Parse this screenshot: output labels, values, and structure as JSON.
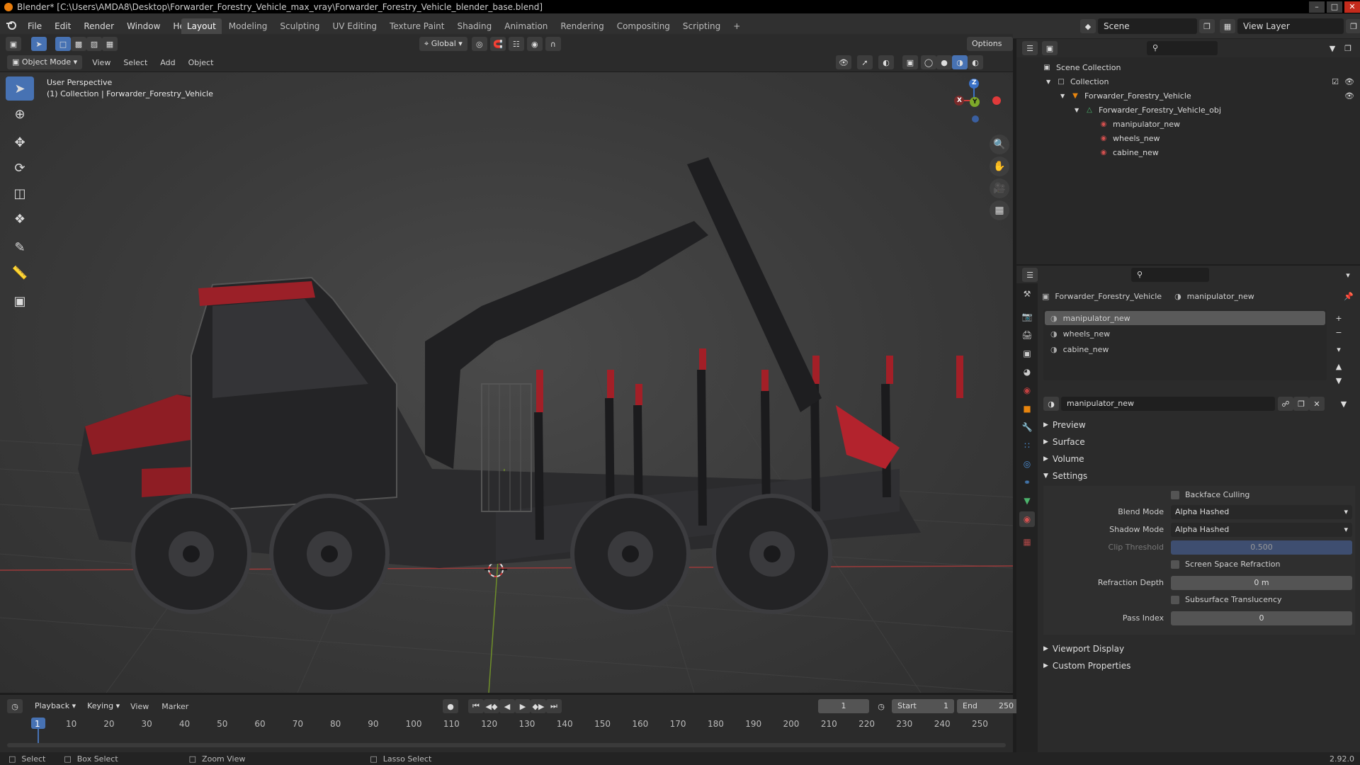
{
  "title": "Blender* [C:\\Users\\AMDA8\\Desktop\\Forwarder_Forestry_Vehicle_max_vray\\Forwarder_Forestry_Vehicle_blender_base.blend]",
  "menu": [
    "File",
    "Edit",
    "Render",
    "Window",
    "Help"
  ],
  "workspaces": [
    "Layout",
    "Modeling",
    "Sculpting",
    "UV Editing",
    "Texture Paint",
    "Shading",
    "Animation",
    "Rendering",
    "Compositing",
    "Scripting"
  ],
  "scene": "Scene",
  "view_layer": "View Layer",
  "viewport": {
    "transform": "Global",
    "options": "Options",
    "mode": "Object Mode",
    "menus": [
      "View",
      "Select",
      "Add",
      "Object"
    ],
    "perspective": "User Perspective",
    "collection_info": "(1) Collection | Forwarder_Forestry_Vehicle",
    "gizmo": {
      "x": "X",
      "y": "Y",
      "z": "Z"
    }
  },
  "outliner": {
    "rows": [
      {
        "label": "Scene Collection",
        "indent": 0,
        "icon": "scene-collection-icon"
      },
      {
        "label": "Collection",
        "indent": 1,
        "icon": "collection-icon"
      },
      {
        "label": "Forwarder_Forestry_Vehicle",
        "indent": 2,
        "icon": "object-icon"
      },
      {
        "label": "Forwarder_Forestry_Vehicle_obj",
        "indent": 3,
        "icon": "mesh-data-icon"
      },
      {
        "label": "manipulator_new",
        "indent": 4,
        "icon": "material-icon"
      },
      {
        "label": "wheels_new",
        "indent": 4,
        "icon": "material-icon"
      },
      {
        "label": "cabine_new",
        "indent": 4,
        "icon": "material-icon"
      }
    ]
  },
  "properties": {
    "breadcrumb_object": "Forwarder_Forestry_Vehicle",
    "breadcrumb_material": "manipulator_new",
    "slots": [
      "manipulator_new",
      "wheels_new",
      "cabine_new"
    ],
    "active_material": "manipulator_new",
    "sections": {
      "preview": "Preview",
      "surface": "Surface",
      "volume": "Volume",
      "settings": "Settings",
      "viewport_display": "Viewport Display",
      "custom_properties": "Custom Properties"
    },
    "settings": {
      "backface_culling": "Backface Culling",
      "blend_mode_label": "Blend Mode",
      "blend_mode": "Alpha Hashed",
      "shadow_mode_label": "Shadow Mode",
      "shadow_mode": "Alpha Hashed",
      "clip_threshold_label": "Clip Threshold",
      "clip_threshold": "0.500",
      "ssr": "Screen Space Refraction",
      "refraction_depth_label": "Refraction Depth",
      "refraction_depth": "0 m",
      "subsurface": "Subsurface Translucency",
      "pass_index_label": "Pass Index",
      "pass_index": "0"
    }
  },
  "timeline": {
    "menus": [
      "Playback",
      "Keying",
      "View",
      "Marker"
    ],
    "current_frame": "1",
    "start_label": "Start",
    "start": "1",
    "end_label": "End",
    "end": "250",
    "ticks": [
      "1",
      "10",
      "20",
      "30",
      "40",
      "50",
      "60",
      "70",
      "80",
      "90",
      "100",
      "110",
      "120",
      "130",
      "140",
      "150",
      "160",
      "170",
      "180",
      "190",
      "200",
      "210",
      "220",
      "230",
      "240",
      "250"
    ]
  },
  "statusbar": {
    "select": "Select",
    "box_select": "Box Select",
    "zoom_view": "Zoom View",
    "lasso_select": "Lasso Select",
    "version": "2.92.0"
  },
  "colors": {
    "accent": "#4772b3",
    "vehicle_red": "#b3232d",
    "axis_x": "#d23a3a",
    "axis_y": "#7ea82a",
    "axis_z": "#3a71c7"
  }
}
